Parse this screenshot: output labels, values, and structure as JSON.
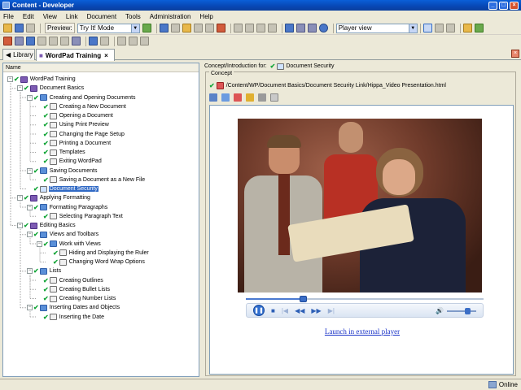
{
  "window": {
    "title": "Content - Developer",
    "minimize": "_",
    "maximize": "□",
    "close": "×"
  },
  "menu": [
    "File",
    "Edit",
    "View",
    "Link",
    "Document",
    "Tools",
    "Administration",
    "Help"
  ],
  "toolbar": {
    "preview_label": "Preview:",
    "mode_value": "Try It! Mode",
    "view_value": "Player view"
  },
  "tabs": [
    {
      "label": "Library"
    },
    {
      "label": "WordPad Training",
      "close": "×"
    }
  ],
  "tree": {
    "header": "Name",
    "items": [
      {
        "label": "WordPad Training",
        "icon": "module"
      },
      {
        "label": "Document Basics",
        "icon": "module"
      },
      {
        "label": "Creating and Opening Documents",
        "icon": "section"
      },
      {
        "label": "Creating a New Document",
        "icon": "topic"
      },
      {
        "label": "Opening a Document",
        "icon": "topic"
      },
      {
        "label": "Using Print Preview",
        "icon": "topic"
      },
      {
        "label": "Changing the Page Setup",
        "icon": "topic"
      },
      {
        "label": "Printing a Document",
        "icon": "topic"
      },
      {
        "label": "Templates",
        "icon": "topic"
      },
      {
        "label": "Exiting WordPad",
        "icon": "topic"
      },
      {
        "label": "Saving Documents",
        "icon": "section"
      },
      {
        "label": "Saving a Document as a New File",
        "icon": "topic"
      },
      {
        "label": "Document Security",
        "icon": "web"
      },
      {
        "label": "Applying Formatting",
        "icon": "module"
      },
      {
        "label": "Formatting Paragraphs",
        "icon": "section"
      },
      {
        "label": "Selecting Paragraph Text",
        "icon": "topic"
      },
      {
        "label": "Editing Basics",
        "icon": "module"
      },
      {
        "label": "Views and Toolbars",
        "icon": "section"
      },
      {
        "label": "Work with Views",
        "icon": "section"
      },
      {
        "label": "Hiding and Displaying the Ruler",
        "icon": "topic"
      },
      {
        "label": "Changing Word Wrap Options",
        "icon": "topic"
      },
      {
        "label": "Lists",
        "icon": "section"
      },
      {
        "label": "Creating Outlines",
        "icon": "topic"
      },
      {
        "label": "Creating Bullet Lists",
        "icon": "topic"
      },
      {
        "label": "Creating Number Lists",
        "icon": "topic"
      },
      {
        "label": "Inserting Dates and Objects",
        "icon": "section"
      },
      {
        "label": "Inserting the Date",
        "icon": "topic"
      }
    ],
    "expander_minus": "−"
  },
  "concept": {
    "header_prefix": "Concept/Introduction for:",
    "header_item": "Document Security",
    "frame_title": "Concept",
    "path": "/Content/WP/Document Basics/Document Security Link/Hippa_Video Presentation.html",
    "check": "✔",
    "launch_link": "Launch in external player"
  },
  "player": {
    "progress_fraction": 0.24,
    "play_glyph": "❚❚",
    "stop_glyph": "■",
    "prev_glyph": "|◀",
    "rewind_glyph": "◀◀",
    "ff_glyph": "▶▶",
    "next_glyph": "▶|",
    "volume_glyph": "🔊",
    "volume_fraction": 0.7
  },
  "status": {
    "connection": "Online"
  }
}
